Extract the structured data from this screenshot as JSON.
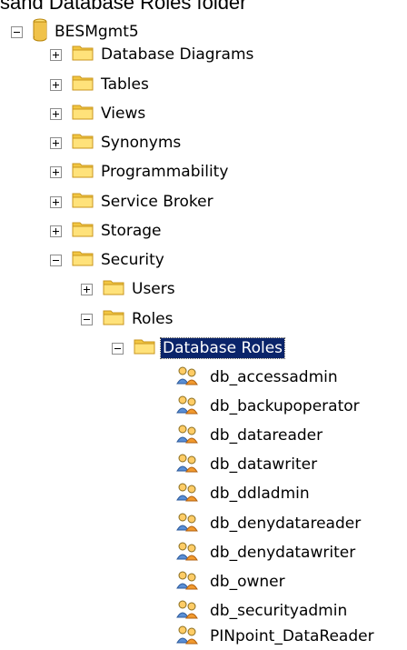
{
  "caption": "sand Database Roles folder",
  "tree": {
    "root": {
      "label": "BESMgmt5",
      "expander": "minus",
      "icon": "database-icon"
    },
    "folders": [
      {
        "label": "Database Diagrams",
        "expander": "plus",
        "icon": "folder-icon"
      },
      {
        "label": "Tables",
        "expander": "plus",
        "icon": "folder-icon"
      },
      {
        "label": "Views",
        "expander": "plus",
        "icon": "folder-icon"
      },
      {
        "label": "Synonyms",
        "expander": "plus",
        "icon": "folder-icon"
      },
      {
        "label": "Programmability",
        "expander": "plus",
        "icon": "folder-icon"
      },
      {
        "label": "Service Broker",
        "expander": "plus",
        "icon": "folder-icon"
      },
      {
        "label": "Storage",
        "expander": "plus",
        "icon": "folder-icon"
      },
      {
        "label": "Security",
        "expander": "minus",
        "icon": "folder-icon"
      }
    ],
    "security": {
      "users": {
        "label": "Users",
        "expander": "plus",
        "icon": "folder-icon"
      },
      "roles": {
        "label": "Roles",
        "expander": "minus",
        "icon": "folder-icon"
      }
    },
    "database_roles": {
      "label": "Database Roles",
      "expander": "minus",
      "icon": "folder-icon",
      "selected": true
    },
    "roles": [
      {
        "label": "db_accessadmin",
        "icon": "database-role-icon"
      },
      {
        "label": "db_backupoperator",
        "icon": "database-role-icon"
      },
      {
        "label": "db_datareader",
        "icon": "database-role-icon"
      },
      {
        "label": "db_datawriter",
        "icon": "database-role-icon"
      },
      {
        "label": "db_ddladmin",
        "icon": "database-role-icon"
      },
      {
        "label": "db_denydatareader",
        "icon": "database-role-icon"
      },
      {
        "label": "db_denydatawriter",
        "icon": "database-role-icon"
      },
      {
        "label": "db_owner",
        "icon": "database-role-icon"
      },
      {
        "label": "db_securityadmin",
        "icon": "database-role-icon"
      },
      {
        "label": "PINpoint_DataReader",
        "icon": "database-role-icon"
      }
    ]
  },
  "colors": {
    "selection_bg": "#0a246a",
    "selection_text": "#ffffff",
    "folder_body": "#f2c641",
    "folder_face": "#ffe27a",
    "database_body": "#f0c24a"
  }
}
